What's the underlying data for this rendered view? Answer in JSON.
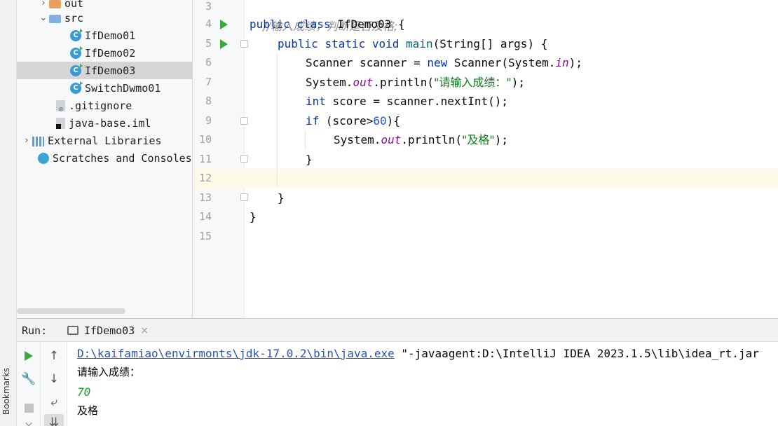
{
  "sidebar": {
    "bookmarks_label": "Bookmarks"
  },
  "project_tree": {
    "items": [
      {
        "label": "out",
        "type": "folder"
      },
      {
        "label": "src",
        "type": "folder"
      },
      {
        "label": "IfDemo01",
        "type": "class"
      },
      {
        "label": "IfDemo02",
        "type": "class"
      },
      {
        "label": "IfDemo03",
        "type": "class",
        "selected": true
      },
      {
        "label": "SwitchDwmo01",
        "type": "class"
      },
      {
        "label": ".gitignore",
        "type": "file"
      },
      {
        "label": "java-base.iml",
        "type": "file"
      },
      {
        "label": "External Libraries",
        "type": "library"
      },
      {
        "label": "Scratches and Consoles",
        "type": "scratch"
      }
    ]
  },
  "editor": {
    "line_numbers": [
      "3",
      "4",
      "5",
      "6",
      "7",
      "8",
      "9",
      "10",
      "11",
      "12",
      "13",
      "14",
      "15"
    ],
    "code": {
      "l3_comment": "//输入成绩，判断是否及格;",
      "l4_public": "public",
      "l4_class": "class",
      "l4_name": "IfDemo03 {",
      "l5_public": "public",
      "l5_static": "static",
      "l5_void": "void",
      "l5_main": "main",
      "l5_rest": "(String[] args) {",
      "l6_a": "Scanner scanner = ",
      "l6_new": "new",
      "l6_b": " Scanner(System.",
      "l6_in": "in",
      "l6_c": ");",
      "l7_a": "System.",
      "l7_out": "out",
      "l7_b": ".println(",
      "l7_str": "\"请输入成绩：\"",
      "l7_c": ");",
      "l8_int": "int",
      "l8_rest": " score = scanner.nextInt();",
      "l9_if": "if",
      "l9_a": " (score>",
      "l9_num": "60",
      "l9_b": "){",
      "l10_a": "System.",
      "l10_out": "out",
      "l10_b": ".println(",
      "l10_str": "\"及格\"",
      "l10_c": ");",
      "l11": "}",
      "l13": "}",
      "l14": "}"
    }
  },
  "run_panel": {
    "label": "Run:",
    "tab_title": "IfDemo03",
    "tab_close": "×",
    "console": {
      "java_path": "D:\\kaifamiao\\envirmonts\\jdk-17.0.2\\bin\\java.exe",
      "java_args": " \"-javaagent:D:\\IntelliJ IDEA 2023.1.5\\lib\\idea_rt.jar",
      "prompt": "请输入成绩：",
      "input": "70",
      "result": "及格"
    }
  },
  "colors": {
    "keyword": "#0033b3",
    "string": "#067d17",
    "number": "#1750eb",
    "static_field": "#871094",
    "comment": "#8c8c8c",
    "run_green": "#3aa83a"
  }
}
